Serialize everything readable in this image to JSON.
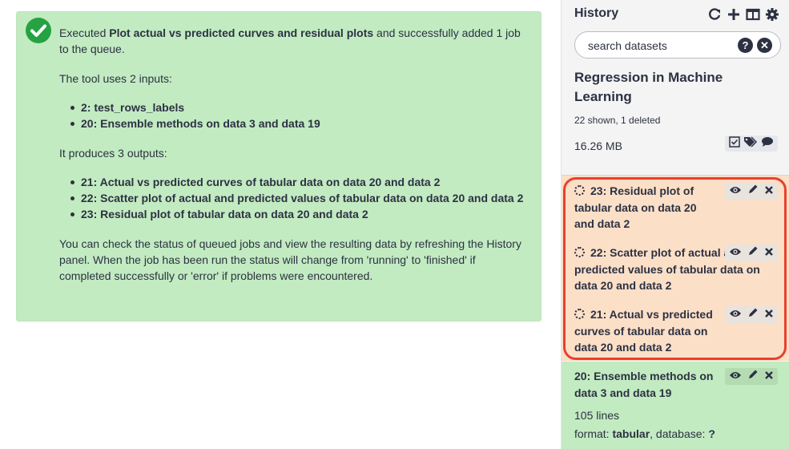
{
  "message": {
    "intro_prefix": "Executed ",
    "tool_name": "Plot actual vs predicted curves and residual plots",
    "intro_suffix": " and successfully added 1 job to the queue.",
    "inputs_header": "The tool uses 2 inputs:",
    "inputs": [
      "2: test_rows_labels",
      "20: Ensemble methods on data 3 and data 19"
    ],
    "outputs_header": "It produces 3 outputs:",
    "outputs": [
      "21: Actual vs predicted curves of tabular data on data 20 and data 2",
      "22: Scatter plot of actual and predicted values of tabular data on data 20 and data 2",
      "23: Residual plot of tabular data on data 20 and data 2"
    ],
    "footer": "You can check the status of queued jobs and view the resulting data by refreshing the History panel. When the job has been run the status will change from 'running' to 'finished' if completed successfully or 'error' if problems were encountered."
  },
  "history": {
    "title": "History",
    "icons": [
      "refresh-icon",
      "plus-icon",
      "columns-icon",
      "gear-icon"
    ],
    "search_placeholder": "search datasets",
    "name": "Regression in Machine Learning",
    "counts": "22 shown, 1 deleted",
    "size": "16.26 MB",
    "datasets": [
      {
        "label": "23: Residual plot of tabular data on data 20 and data 2",
        "state": "queued"
      },
      {
        "label": "22: Scatter plot of actual and predicted values of tabular data on data 20 and data 2",
        "state": "queued"
      },
      {
        "label": "21: Actual vs predicted curves of tabular data on data 20 and data 2",
        "state": "queued"
      },
      {
        "label": "20: Ensemble methods on data 3 and data 19",
        "state": "ok",
        "lines": "105 lines",
        "format_label": "format: ",
        "format": "tabular",
        "db_label": ", database: ",
        "database": "?"
      }
    ]
  },
  "colors": {
    "success_bg": "#c2ebc1",
    "success_icon": "#25a242",
    "queued_bg": "#fbdfc7",
    "highlight": "#e8402f"
  }
}
